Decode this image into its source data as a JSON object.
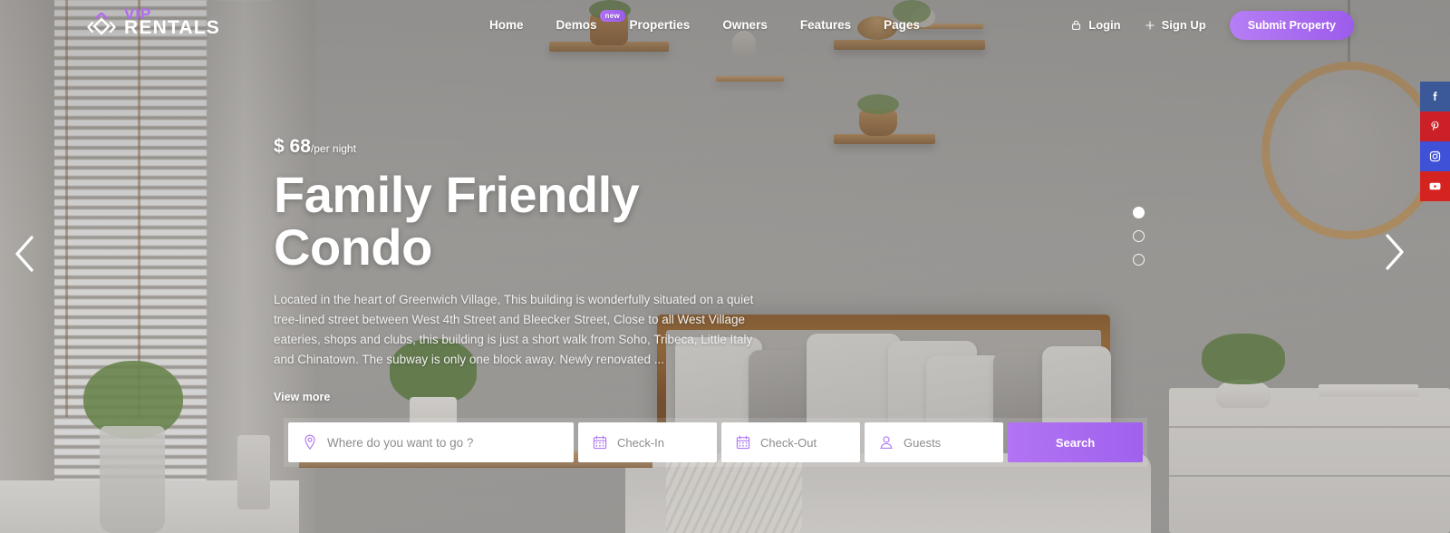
{
  "brand": {
    "logo_top": "VIP",
    "logo_main": "RENTALS",
    "logo_icon": "diamond-chevron-icon"
  },
  "nav": {
    "links": [
      {
        "label": "Home",
        "badge": ""
      },
      {
        "label": "Demos",
        "badge": "new"
      },
      {
        "label": "Properties",
        "badge": ""
      },
      {
        "label": "Owners",
        "badge": ""
      },
      {
        "label": "Features",
        "badge": ""
      },
      {
        "label": "Pages",
        "badge": ""
      }
    ],
    "login_label": "Login",
    "login_icon": "lock-icon",
    "signup_label": "Sign Up",
    "signup_icon": "plus-icon",
    "submit_label": "Submit Property"
  },
  "hero": {
    "price_currency": "$",
    "price_amount": "68",
    "price_unit": "/per night",
    "title": "Family Friendly Condo",
    "description": "Located in the heart of Greenwich Village, This building is wonderfully situated on a quiet tree-lined street between West 4th Street and Bleecker Street, Close to all West Village eateries, shops and clubs, this building is just a short walk from Soho, Tribeca, Little Italy and Chinatown. The subway is only one block away. Newly renovated ...",
    "view_more_label": "View more"
  },
  "slider": {
    "prev_icon": "chevron-left-icon",
    "next_icon": "chevron-right-icon",
    "total_slides": 3,
    "active_slide": 1
  },
  "search": {
    "destination_placeholder": "Where do you want to go ?",
    "destination_value": "",
    "destination_icon": "map-pin-icon",
    "checkin_placeholder": "Check-In",
    "checkin_value": "",
    "checkin_icon": "calendar-icon",
    "checkout_placeholder": "Check-Out",
    "checkout_value": "",
    "checkout_icon": "calendar-icon",
    "guests_placeholder": "Guests",
    "guests_value": "",
    "guests_icon": "user-icon",
    "search_label": "Search"
  },
  "social": [
    {
      "name": "facebook",
      "icon": "facebook-icon",
      "color": "#3b5998"
    },
    {
      "name": "pinterest",
      "icon": "pinterest-icon",
      "color": "#cb2027"
    },
    {
      "name": "instagram",
      "icon": "instagram-icon",
      "color": "#3f51d6"
    },
    {
      "name": "youtube",
      "icon": "youtube-icon",
      "color": "#d5241f"
    }
  ],
  "colors": {
    "accent": "#a967ee",
    "accent_light": "#b67ef5",
    "text_light": "#ffffff"
  }
}
